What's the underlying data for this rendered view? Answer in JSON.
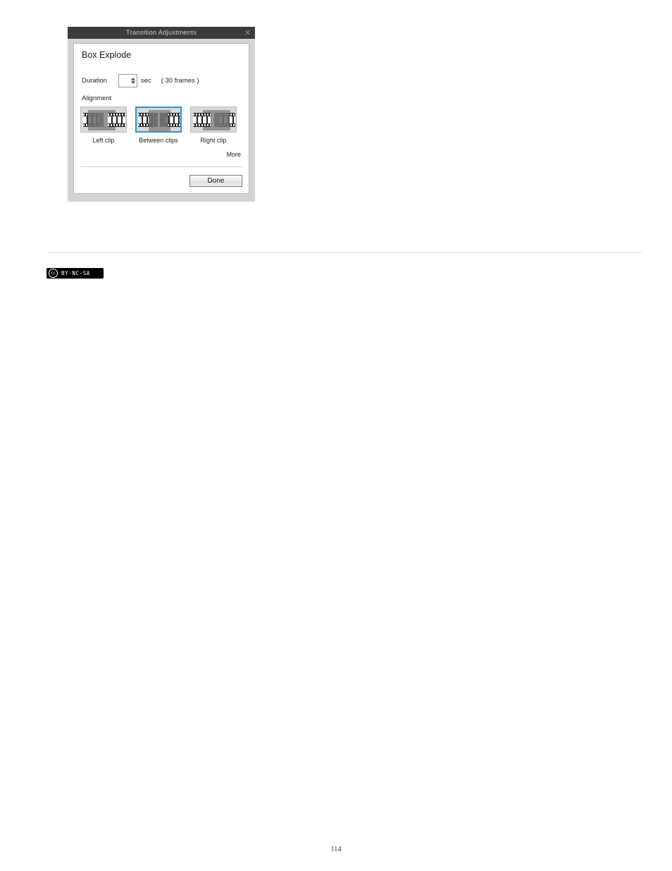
{
  "dialog": {
    "title": "Transition Adjustments",
    "close_icon": "close-icon",
    "panel_title": "Box Explode",
    "duration": {
      "label": "Duration",
      "value": "",
      "placeholder": "",
      "unit": "sec",
      "frames": "( 30 frames )",
      "spinner_up_icon": "arrow-up-icon",
      "spinner_down_icon": "arrow-down-icon"
    },
    "alignment": {
      "label": "Alignment",
      "options": [
        {
          "label": "Left clip",
          "icon": "filmstrip-left-clip-icon",
          "selected": false
        },
        {
          "label": "Between clips",
          "icon": "filmstrip-between-clips-icon",
          "selected": true
        },
        {
          "label": "Right clip",
          "icon": "filmstrip-right-clip-icon",
          "selected": false
        }
      ],
      "more_label": "More"
    },
    "done_label": "Done",
    "accent_color": "#1e9ae0",
    "titlebar_color": "#3b3b3b"
  },
  "footer": {
    "license_mark": "cc",
    "license_text": "BY-NC-SA",
    "page_number": "114"
  }
}
